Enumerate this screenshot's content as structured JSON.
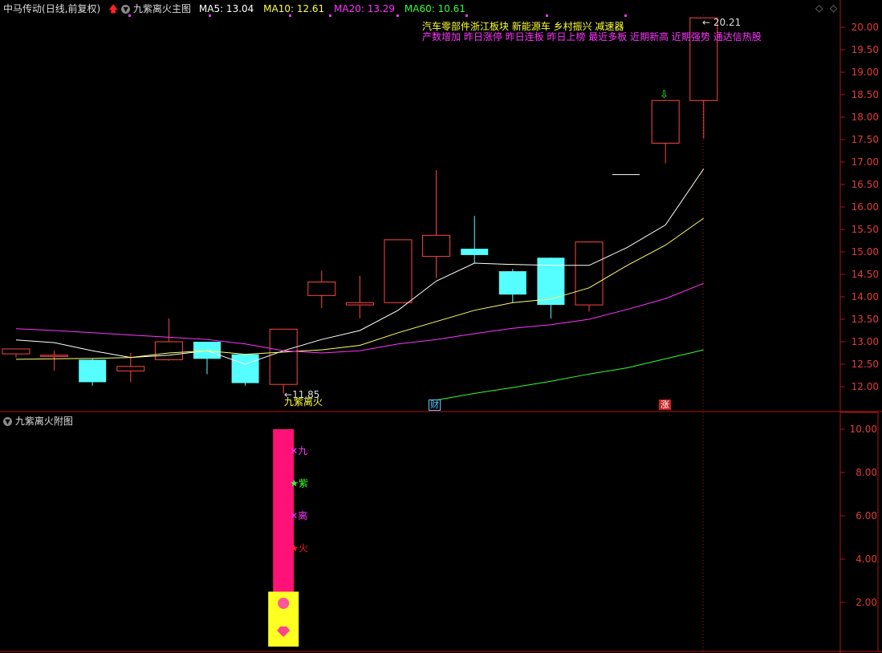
{
  "header": {
    "stock_name": "中马传动",
    "period": "(日线,前复权)",
    "main_indicator": "九紫离火主图",
    "ma": [
      {
        "label": "MA5: 13.04",
        "color": "#ffffff"
      },
      {
        "label": "MA10: 12.61",
        "color": "#ffff4d"
      },
      {
        "label": "MA20: 13.29",
        "color": "#ff33ff"
      },
      {
        "label": "MA60: 10.61",
        "color": "#33ff33"
      }
    ]
  },
  "tags": {
    "line1": "汽车零部件",
    "line1b": "浙江板块  新能源车  乡村振兴  减速器",
    "line2": "产数增加  昨日涨停  昨日连板  昨日上榜  最近多板  近期新高  近期强势  通达信热股"
  },
  "annotations": {
    "high_label": "20.21",
    "low_label": "11.85",
    "signal_text": "九紫离火",
    "cai_badge": "财",
    "zhang_badge": "涨"
  },
  "sub_panel": {
    "title": "九紫离火附图",
    "markers": [
      {
        "char": "九",
        "color": "#ff33ff",
        "value": 9.0,
        "star": "✕"
      },
      {
        "char": "紫",
        "color": "#33ff33",
        "value": 7.5,
        "star": "★"
      },
      {
        "char": "离",
        "color": "#ff33ff",
        "value": 6.0,
        "star": "✕"
      },
      {
        "char": "火",
        "color": "#ff2222",
        "value": 4.5,
        "star": "★"
      }
    ],
    "bar_value": 10,
    "yellow_value": 2.5
  },
  "colors": {
    "up": "#ff4444",
    "down": "#55ffff",
    "border": "#b01515",
    "ma5": "#ffffff",
    "ma10": "#ffff66",
    "ma20": "#ff33ff",
    "ma60": "#33ff33"
  },
  "chart_data": [
    {
      "type": "candlestick",
      "title": "九紫离火主图",
      "ylim": [
        11.6,
        20.4
      ],
      "yticks": [
        "12.00",
        "12.50",
        "13.00",
        "13.50",
        "14.00",
        "14.50",
        "15.00",
        "15.50",
        "16.00",
        "16.50",
        "17.00",
        "17.50",
        "18.00",
        "18.50",
        "19.00",
        "19.50",
        "20.00"
      ],
      "candles": [
        {
          "o": 12.73,
          "h": 12.84,
          "l": 12.65,
          "c": 12.84
        },
        {
          "o": 12.7,
          "h": 12.8,
          "l": 12.35,
          "c": 12.7
        },
        {
          "o": 12.6,
          "h": 12.62,
          "l": 12.02,
          "c": 12.1
        },
        {
          "o": 12.35,
          "h": 12.75,
          "l": 12.1,
          "c": 12.45
        },
        {
          "o": 12.6,
          "h": 13.52,
          "l": 12.58,
          "c": 13.0
        },
        {
          "o": 13.0,
          "h": 13.0,
          "l": 12.28,
          "c": 12.62
        },
        {
          "o": 12.72,
          "h": 12.72,
          "l": 12.02,
          "c": 12.08
        },
        {
          "o": 12.05,
          "h": 12.05,
          "l": 11.85,
          "c": 13.28
        },
        {
          "o": 14.03,
          "h": 14.58,
          "l": 13.75,
          "c": 14.33
        },
        {
          "o": 13.82,
          "h": 14.47,
          "l": 13.52,
          "c": 13.87
        },
        {
          "o": 13.87,
          "h": 13.95,
          "l": 13.87,
          "c": 15.27
        },
        {
          "o": 14.9,
          "h": 16.82,
          "l": 14.42,
          "c": 15.37
        },
        {
          "o": 15.07,
          "h": 15.8,
          "l": 14.75,
          "c": 14.93
        },
        {
          "o": 14.57,
          "h": 14.62,
          "l": 13.87,
          "c": 14.05
        },
        {
          "o": 14.87,
          "h": 14.87,
          "l": 13.52,
          "c": 13.82
        },
        {
          "o": 13.82,
          "h": 15.22,
          "l": 13.67,
          "c": 15.22
        },
        null,
        {
          "o": 17.42,
          "h": 18.37,
          "l": 16.97,
          "c": 18.37
        },
        {
          "o": 18.37,
          "h": 20.21,
          "l": 17.52,
          "c": 20.21
        }
      ],
      "series": [
        {
          "name": "MA5",
          "values": [
            13.04,
            12.98,
            12.8,
            12.65,
            12.7,
            12.8,
            12.5,
            12.8,
            13.05,
            13.25,
            13.7,
            14.35,
            14.75,
            14.72,
            14.7,
            14.7,
            15.1,
            15.6,
            16.85
          ]
        },
        {
          "name": "MA10",
          "values": [
            12.61,
            12.62,
            12.63,
            12.65,
            12.75,
            12.8,
            12.72,
            12.77,
            12.82,
            12.92,
            13.2,
            13.45,
            13.7,
            13.87,
            13.95,
            14.2,
            14.7,
            15.15,
            15.75
          ]
        },
        {
          "name": "MA20",
          "values": [
            13.29,
            13.25,
            13.2,
            13.15,
            13.1,
            13.05,
            12.95,
            12.8,
            12.75,
            12.8,
            12.95,
            13.05,
            13.18,
            13.3,
            13.38,
            13.5,
            13.72,
            13.96,
            14.3
          ]
        },
        {
          "name": "MA60",
          "values": [
            null,
            null,
            null,
            null,
            null,
            null,
            null,
            null,
            null,
            null,
            null,
            11.7,
            11.85,
            11.98,
            12.12,
            12.28,
            12.42,
            12.62,
            12.82
          ]
        }
      ]
    },
    {
      "type": "bar",
      "title": "九紫离火附图",
      "ylim": [
        0,
        10.5
      ],
      "yticks": [
        "2.00",
        "4.00",
        "6.00",
        "8.00",
        "10.00"
      ]
    }
  ]
}
